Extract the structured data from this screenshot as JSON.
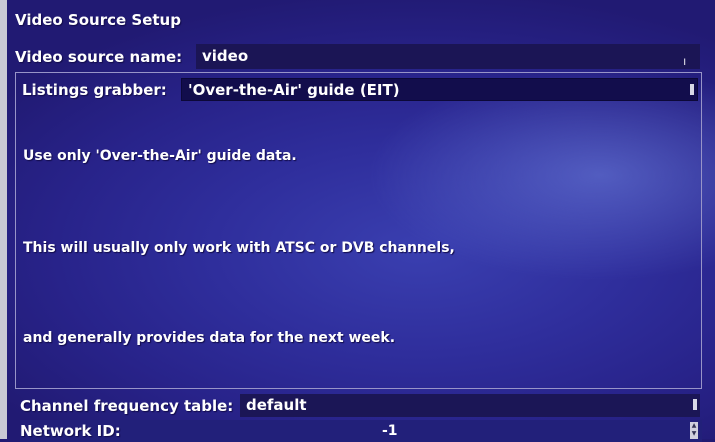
{
  "window": {
    "title": "Video Source Setup"
  },
  "video_source_name": {
    "label": "Video source name:",
    "value": "video",
    "caret": "I"
  },
  "listings_grabber": {
    "label": "Listings grabber:",
    "value": "'Over-the-Air' guide (EIT)",
    "help_lines": [
      "Use only 'Over-the-Air' guide data.",
      "This will usually only work with ATSC or DVB channels,",
      "and generally provides data for the next week."
    ]
  },
  "channel_frequency_table": {
    "label": "Channel frequency table:",
    "value": "default"
  },
  "network_id": {
    "label": "Network ID:",
    "value": "-1",
    "spinner_up": "▲",
    "spinner_down": "▼"
  },
  "colors": {
    "background": "#2f2e9c",
    "field_background": "#1a1559",
    "text": "#ffffff",
    "panel_border": "#9894c8",
    "frame": "#c9c9d4"
  }
}
